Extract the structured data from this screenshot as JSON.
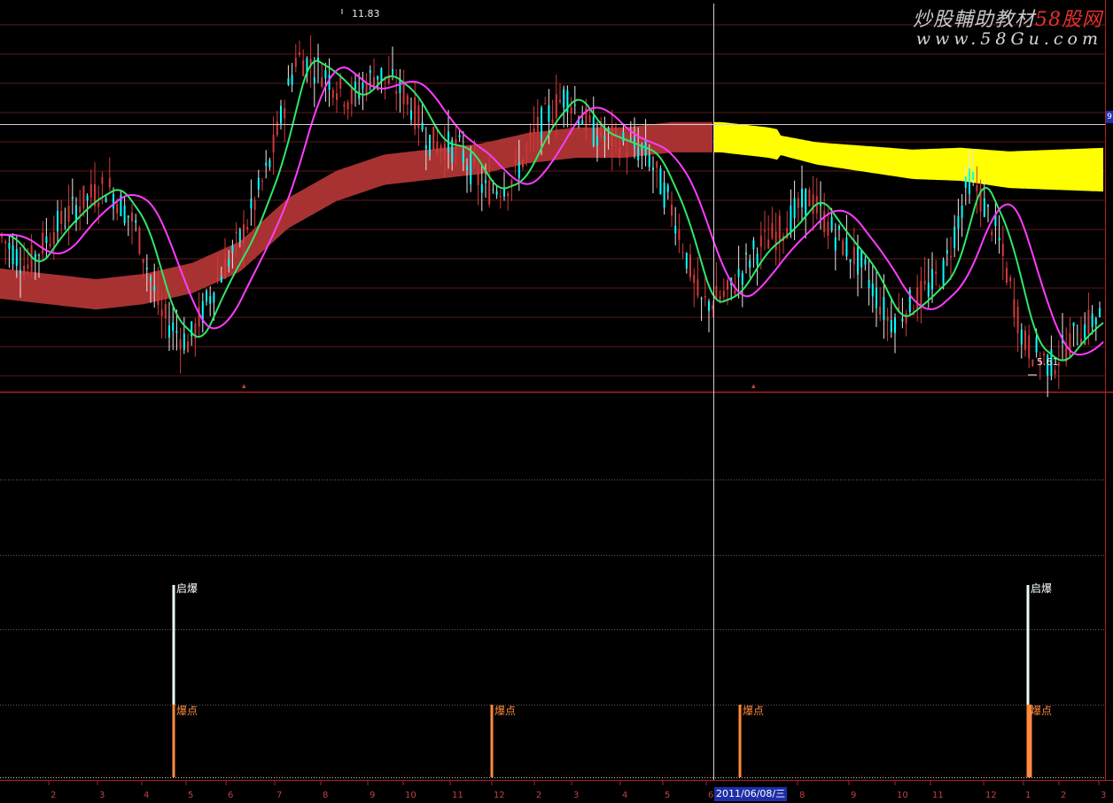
{
  "watermark": {
    "title_prefix": "炒股輔助教材",
    "title_brand": "58股网",
    "url": "www.58Gu.com"
  },
  "price_panel": {
    "high_label": "11.83",
    "low_label": "5.61",
    "right_tag": "9",
    "colors": {
      "candle_up": "#d23a3a",
      "candle_down": "#00ffff",
      "wick": "#e8e8e8",
      "fast_ma": "#2ee86a",
      "mid_ma": "#ff3cff",
      "ribbon_past": "#a83232",
      "ribbon_future": "#ffff00",
      "grid": "#5a1a1a",
      "crosshair": "#cfcfcf"
    }
  },
  "indicator_panel": {
    "qibao_label": "启爆",
    "baodian_label": "爆点",
    "colors": {
      "qibao_bar": "#e8fff0",
      "baodian_bar": "#ff8a3c",
      "qibao_text": "#ffffff",
      "baodian_text": "#ff8a3c",
      "dotted_line": "#b0b0b0"
    }
  },
  "x_axis": {
    "cursor_date": "2011/06/08/三",
    "ticks": [
      "2",
      "3",
      "4",
      "5",
      "6",
      "7",
      "8",
      "9",
      "10",
      "11",
      "12",
      "2",
      "3",
      "4",
      "5",
      "6",
      "8",
      "9",
      "10",
      "11",
      "12",
      "1",
      "2",
      "3"
    ]
  },
  "chart_data": {
    "type": "line",
    "title": "",
    "series": [
      {
        "name": "",
        "values": [
          8.0,
          7.4,
          8.1,
          8.6,
          8.9,
          8.2,
          6.5,
          6.0,
          7.1,
          8.0,
          9.3,
          11.3,
          11.0,
          10.5,
          11.0,
          10.6,
          9.7,
          9.6,
          8.8,
          9.0,
          10.0,
          10.6,
          9.9,
          9.7,
          9.5,
          8.4,
          6.7,
          6.9,
          7.7,
          8.1,
          8.7,
          8.0,
          7.4,
          6.4,
          6.8,
          7.3,
          9.1,
          8.0,
          6.0,
          5.6,
          6.2,
          6.6
        ]
      },
      {
        "name": "",
        "values": [
          7.1,
          7.0,
          6.9,
          7.0,
          7.2,
          7.6,
          8.4,
          8.9,
          9.2,
          9.3,
          9.4,
          9.6,
          9.7,
          9.7,
          9.8,
          9.8,
          9.7,
          9.5,
          9.4,
          9.3,
          9.3,
          9.2,
          9.2,
          9.2
        ]
      }
    ],
    "price_labels": {
      "high": 11.83,
      "low": 5.61
    },
    "signals": [
      {
        "label": "启爆",
        "count": 2
      },
      {
        "label": "爆点",
        "count": 4
      }
    ]
  }
}
